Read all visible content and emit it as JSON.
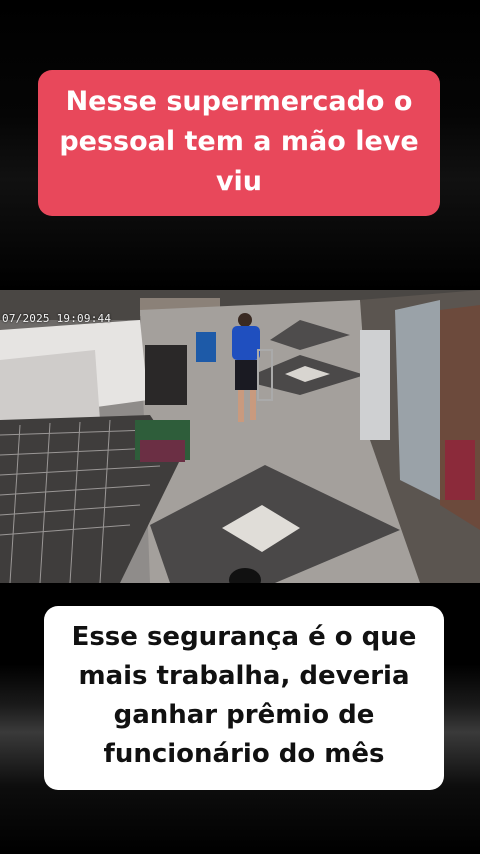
{
  "captions": {
    "top": "Nesse supermercado o pessoal tem a mão leve viu",
    "bottom": "Esse segurança é o que mais trabalha, deveria ganhar prêmio de funcionário do mês"
  },
  "video": {
    "timestamp": "07/2025 19:09:44"
  },
  "colors": {
    "top_caption_bg": "#e8485b",
    "bottom_caption_bg": "#ffffff"
  }
}
